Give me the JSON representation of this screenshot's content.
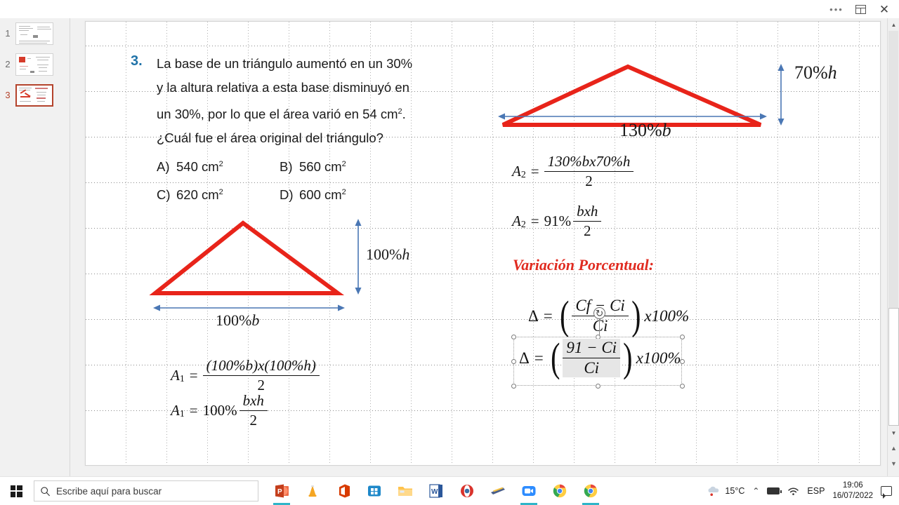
{
  "window": {
    "more_label": "•••",
    "restore_label": "restore-window",
    "close_label": "✕"
  },
  "slide_panel": {
    "slides": [
      {
        "number": "1",
        "selected": false
      },
      {
        "number": "2",
        "selected": false
      },
      {
        "number": "3",
        "selected": true
      }
    ]
  },
  "slide": {
    "question_number": "3.",
    "question_lines": [
      "La base de un triángulo aumentó en un 30%",
      "y la altura relativa a esta base disminuyó en",
      "un 30%, por lo que el área varió en 54 cm",
      "¿Cuál fue el área original del triángulo?"
    ],
    "question_l3_sup": "2",
    "question_l3_tail": ".",
    "options": [
      {
        "label": "A)",
        "value": "540 cm",
        "sup": "2"
      },
      {
        "label": "B)",
        "value": "560 cm",
        "sup": "2"
      },
      {
        "label": "C)",
        "value": "620 cm",
        "sup": "2"
      },
      {
        "label": "D)",
        "value": "600 cm",
        "sup": "2"
      }
    ],
    "triangle_original": {
      "height_label_pct": "100%",
      "height_label_var": "h",
      "base_label_pct": "100%",
      "base_label_var": "b"
    },
    "triangle_modified": {
      "height_label_pct": "70%",
      "height_label_var": "h",
      "base_label_pct": "130%",
      "base_label_var": "b"
    },
    "formula_a1_1": {
      "lhs": "A",
      "lhs_sub": "1",
      "eq": "=",
      "numerator": "(100%b)x(100%h)",
      "denominator": "2"
    },
    "formula_a1_2": {
      "lhs": "A",
      "lhs_sub": "1",
      "eq": "=",
      "coeff": "100%",
      "numerator": "bxh",
      "denominator": "2"
    },
    "formula_a2_1": {
      "lhs": "A",
      "lhs_sub": "2",
      "eq": "=",
      "numerator": "130%bx70%h",
      "denominator": "2"
    },
    "formula_a2_2": {
      "lhs": "A",
      "lhs_sub": "2",
      "eq": "=",
      "coeff": "91%",
      "numerator": "bxh",
      "denominator": "2"
    },
    "variacion_title": "Variación Porcentual:",
    "formula_delta_1": {
      "lhs": "Δ",
      "eq": "=",
      "numerator": "Cf − Ci",
      "denominator": "Ci",
      "tail": "x100%"
    },
    "formula_delta_2": {
      "lhs": "Δ",
      "eq": "=",
      "numerator": "91 − Ci",
      "denominator": "Ci",
      "tail": "x100%"
    },
    "colors": {
      "triangle_red": "#e8241a",
      "arrow_blue": "#4a77b4",
      "question_number_blue": "#1f72a8",
      "variacion_red": "#e02b20"
    }
  },
  "scrollbar": {
    "up_arrow": "▲",
    "down_arrow": "▼",
    "prev_slide": "▲",
    "next_slide": "▼"
  },
  "taskbar": {
    "start_label": "start-menu",
    "search_placeholder": "Escribe aquí para buscar",
    "apps": [
      {
        "name": "powerpoint",
        "state": "active"
      },
      {
        "name": "vlc",
        "state": "pinned"
      },
      {
        "name": "office",
        "state": "pinned"
      },
      {
        "name": "microsoft-store",
        "state": "pinned"
      },
      {
        "name": "file-explorer",
        "state": "pinned"
      },
      {
        "name": "word",
        "state": "pinned"
      },
      {
        "name": "opera",
        "state": "pinned"
      },
      {
        "name": "paint-tool",
        "state": "pinned"
      },
      {
        "name": "zoom",
        "state": "open"
      },
      {
        "name": "chrome-1",
        "state": "pinned"
      },
      {
        "name": "chrome-2",
        "state": "open"
      }
    ],
    "weather_temp": "15°C",
    "chevron": "⌃",
    "language": "ESP",
    "time": "19:06",
    "date": "16/07/2022"
  }
}
